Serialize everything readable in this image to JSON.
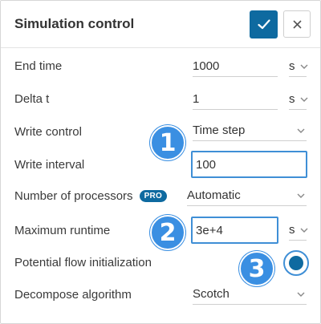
{
  "dialog": {
    "title": "Simulation control",
    "confirm_icon": "check-icon",
    "close_icon": "close-icon"
  },
  "rows": {
    "end_time": {
      "label": "End time",
      "value": "1000",
      "unit": "s"
    },
    "delta_t": {
      "label": "Delta t",
      "value": "1",
      "unit": "s"
    },
    "write_control": {
      "label": "Write control",
      "value": "Time step"
    },
    "write_interval": {
      "label": "Write interval",
      "value": "100"
    },
    "num_processors": {
      "label": "Number of processors",
      "badge": "PRO",
      "value": "Automatic"
    },
    "max_runtime": {
      "label": "Maximum runtime",
      "value": "3e+4",
      "unit": "s"
    },
    "potential_flow": {
      "label": "Potential flow initialization",
      "checked": true
    },
    "decompose": {
      "label": "Decompose algorithm",
      "value": "Scotch"
    }
  },
  "markers": [
    "1",
    "2",
    "3"
  ],
  "colors": {
    "accent": "#0e6aa0",
    "highlight": "#3f8fd6",
    "marker": "#3a8fe2"
  }
}
